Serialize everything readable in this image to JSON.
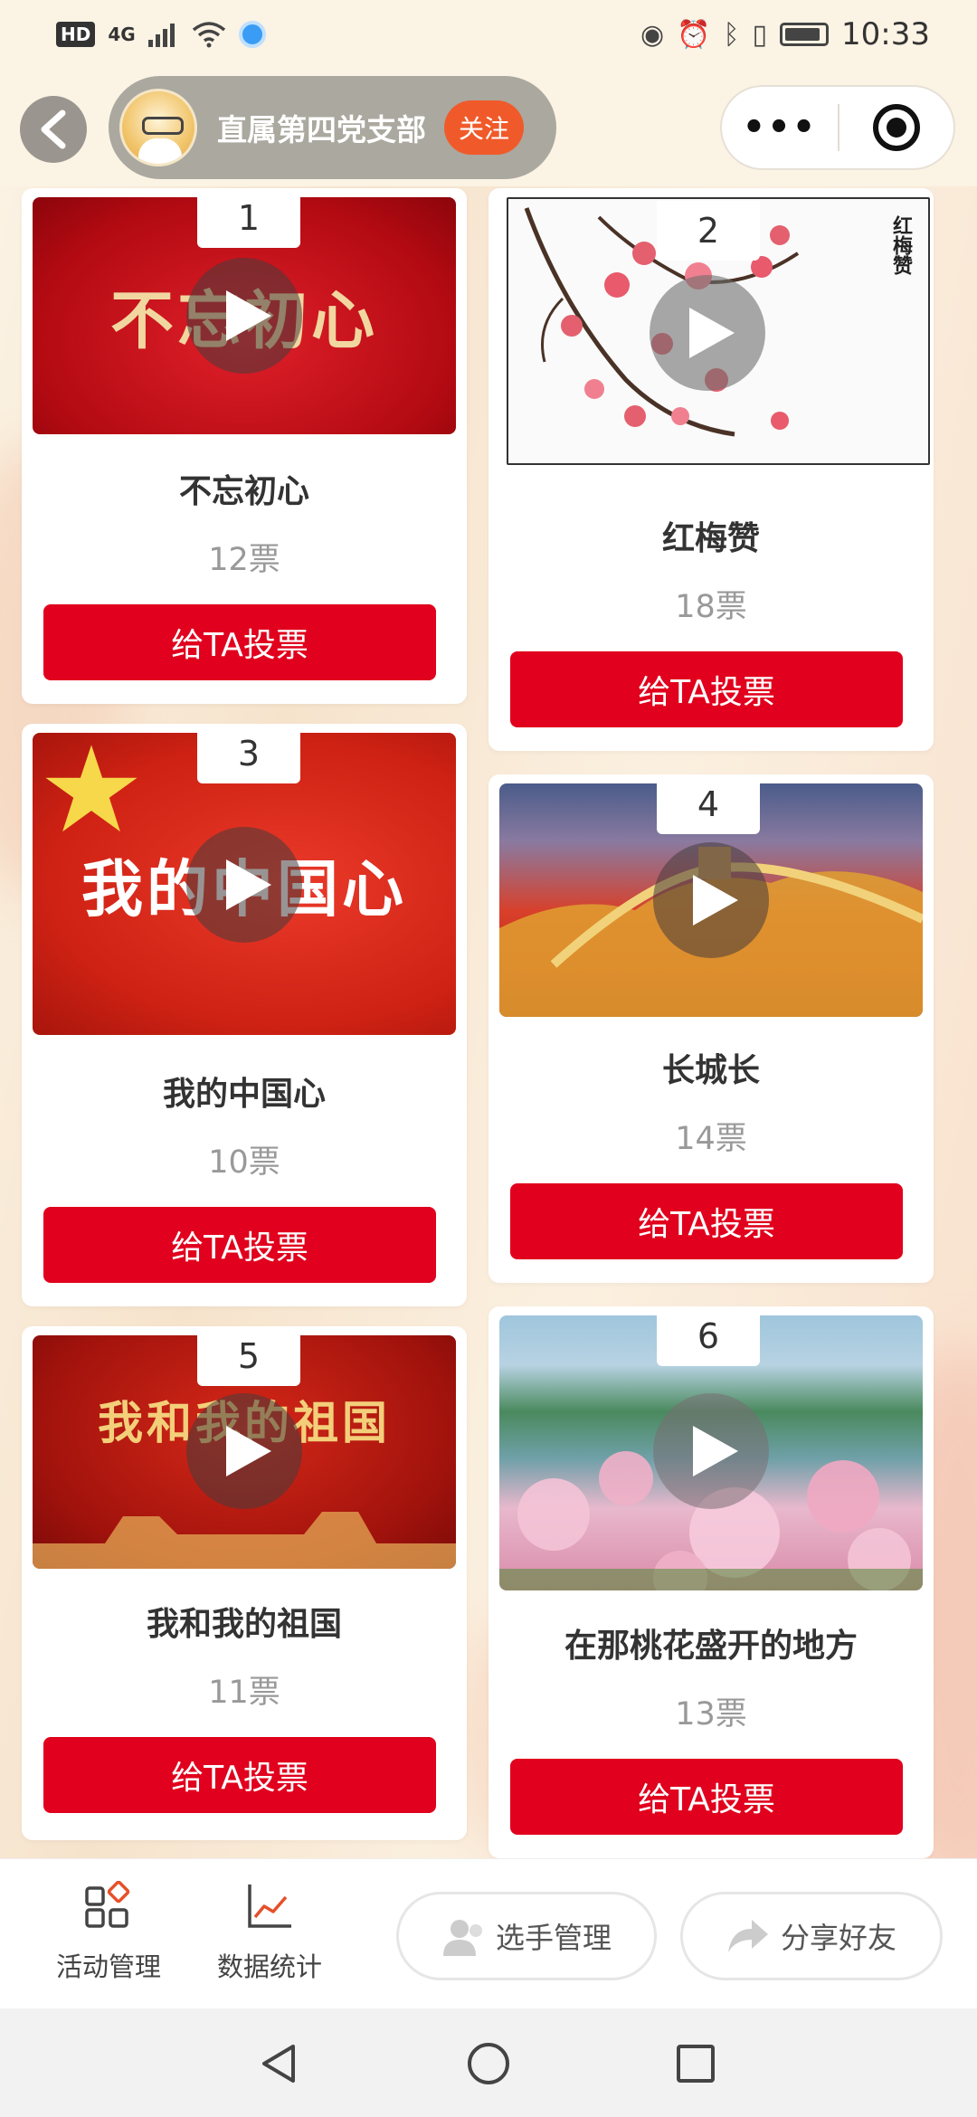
{
  "status_bar": {
    "hd": "HD",
    "network": "4G",
    "time": "10:33"
  },
  "header": {
    "back_icon": "chevron-left-icon",
    "account_name": "直属第四党支部",
    "follow_label": "关注",
    "more_icon": "more-dots-icon",
    "close_icon": "target-circle-icon"
  },
  "cards": [
    {
      "number": "1",
      "thumb_text": "不忘初心",
      "title": "不忘初心",
      "votes": "12票",
      "button": "给TA投票"
    },
    {
      "number": "2",
      "thumb_text": "红梅赞",
      "title": "红梅赞",
      "votes": "18票",
      "button": "给TA投票"
    },
    {
      "number": "3",
      "thumb_text": "我的中国心",
      "title": "我的中国心",
      "votes": "10票",
      "button": "给TA投票"
    },
    {
      "number": "4",
      "thumb_text": "",
      "title": "长城长",
      "votes": "14票",
      "button": "给TA投票"
    },
    {
      "number": "5",
      "thumb_text": "我和我的祖国",
      "title": "我和我的祖国",
      "votes": "11票",
      "button": "给TA投票"
    },
    {
      "number": "6",
      "thumb_text": "",
      "title": "在那桃花盛开的地方",
      "votes": "13票",
      "button": "给TA投票"
    }
  ],
  "bottom_bar": {
    "activity_label": "活动管理",
    "stats_label": "数据统计",
    "contestants_label": "选手管理",
    "share_label": "分享好友"
  },
  "colors": {
    "accent_red": "#e1001d",
    "follow_orange": "#f05a2a"
  }
}
